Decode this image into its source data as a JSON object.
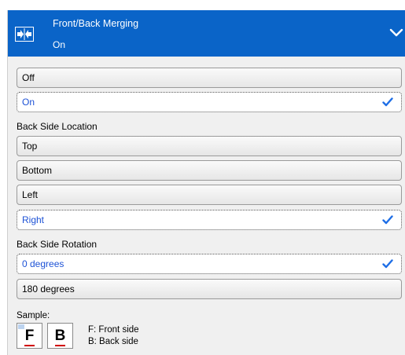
{
  "header": {
    "title": "Front/Back Merging",
    "value": "On",
    "icon": "merge-arrows-icon",
    "background": "#0a64c8"
  },
  "merging_options": [
    {
      "label": "Off",
      "selected": false
    },
    {
      "label": "On",
      "selected": true
    }
  ],
  "location": {
    "label": "Back Side Location",
    "options": [
      {
        "label": "Top",
        "selected": false
      },
      {
        "label": "Bottom",
        "selected": false
      },
      {
        "label": "Left",
        "selected": false
      },
      {
        "label": "Right",
        "selected": true
      }
    ]
  },
  "rotation": {
    "label": "Back Side Rotation",
    "options": [
      {
        "label": "0 degrees",
        "selected": true
      },
      {
        "label": "180 degrees",
        "selected": false
      }
    ]
  },
  "sample": {
    "label": "Sample:",
    "front_letter": "F",
    "back_letter": "B",
    "front_legend": "F: Front side",
    "back_legend": "B: Back side"
  },
  "colors": {
    "accent": "#0a64c8",
    "selected_text": "#1d52d6",
    "check": "#1e6ee6"
  }
}
